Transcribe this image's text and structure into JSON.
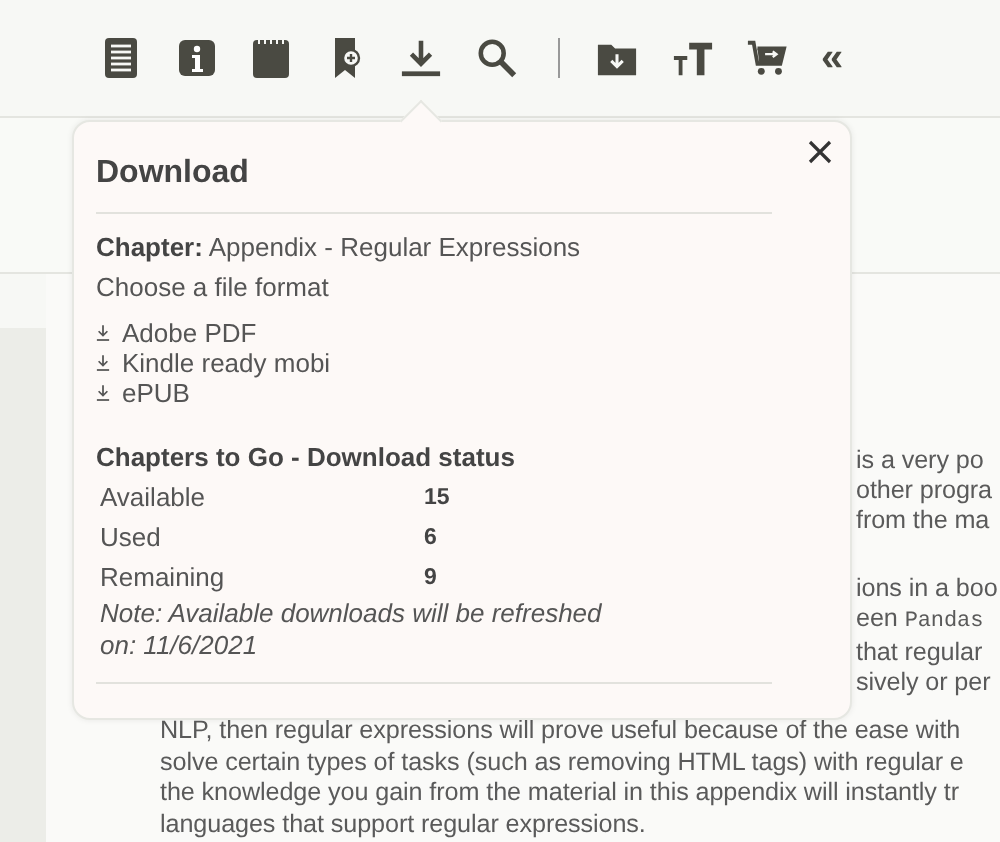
{
  "toolbar": {
    "collapse": "«"
  },
  "popover": {
    "title": "Download",
    "chapter_label": "Chapter:",
    "chapter": "Appendix - Regular Expressions",
    "prompt": "Choose a file format",
    "formats": [
      "Adobe PDF",
      "Kindle ready mobi",
      "ePUB"
    ],
    "status_title": "Chapters to Go - Download status",
    "stats": [
      {
        "label": "Available",
        "value": "15"
      },
      {
        "label": "Used",
        "value": "6"
      },
      {
        "label": "Remaining",
        "value": "9"
      }
    ],
    "note": "Note: Available downloads will be refreshed on: 11/6/2021"
  },
  "article": {
    "fragments": [
      {
        "text": "is a very po"
      },
      {
        "text": "other progra"
      },
      {
        "text": "from the ma"
      }
    ],
    "fragments_2": [
      {
        "text": "ions in a boo"
      },
      {
        "text": "een ",
        "code": "Pandas"
      },
      {
        "text": "that regular"
      },
      {
        "text": "sively or per"
      }
    ],
    "lines": [
      "NLP, then regular expressions will prove useful because of the ease with",
      "solve certain types of tasks (such as removing HTML tags) with regular e",
      "the knowledge you gain from the material in this appendix will instantly tr",
      "languages that support regular expressions."
    ]
  }
}
